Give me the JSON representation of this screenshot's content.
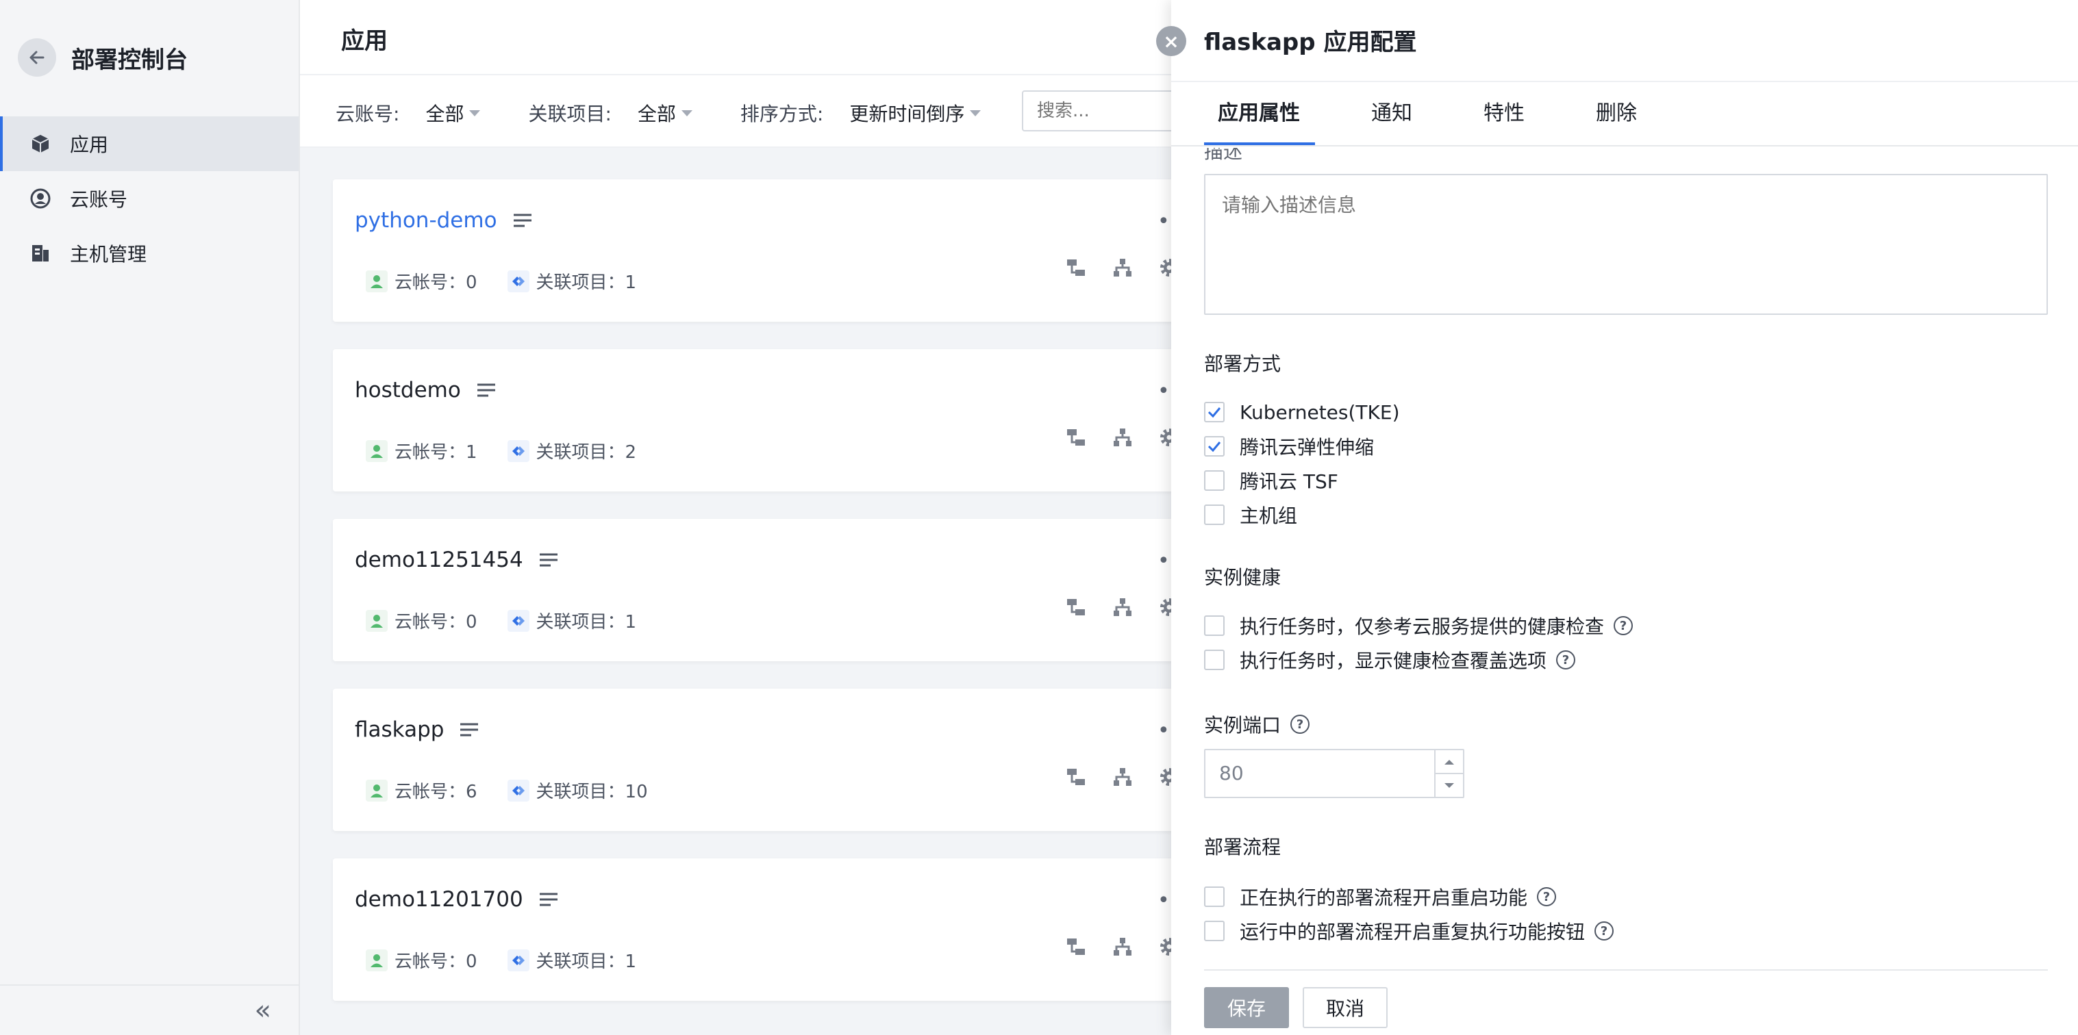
{
  "sidebar": {
    "title": "部署控制台",
    "items": [
      {
        "label": "应用",
        "icon": "cube-icon",
        "active": true
      },
      {
        "label": "云账号",
        "icon": "user-circle-icon",
        "active": false
      },
      {
        "label": "主机管理",
        "icon": "server-icon",
        "active": false
      }
    ],
    "collapse_glyph": "«"
  },
  "main": {
    "title": "应用",
    "filters": {
      "account_label": "云账号:",
      "account_value": "全部",
      "project_label": "关联项目:",
      "project_value": "全部",
      "sort_label": "排序方式:",
      "sort_value": "更新时间倒序"
    },
    "search_placeholder": "搜索...",
    "apps": [
      {
        "name": "python-demo",
        "is_link": true,
        "account_text": "云帐号：0",
        "project_text": "关联项目：1"
      },
      {
        "name": "hostdemo",
        "is_link": false,
        "account_text": "云帐号：1",
        "project_text": "关联项目：2"
      },
      {
        "name": "demo11251454",
        "is_link": false,
        "account_text": "云帐号：0",
        "project_text": "关联项目：1"
      },
      {
        "name": "flaskapp",
        "is_link": false,
        "account_text": "云帐号：6",
        "project_text": "关联项目：10"
      },
      {
        "name": "demo11201700",
        "is_link": false,
        "account_text": "云帐号：0",
        "project_text": "关联项目：1"
      }
    ]
  },
  "drawer": {
    "title": "flaskapp 应用配置",
    "tabs": [
      "应用属性",
      "通知",
      "特性",
      "删除"
    ],
    "desc_label": "描述",
    "desc_placeholder": "请输入描述信息",
    "deploy_method_label": "部署方式",
    "deploy_methods": [
      {
        "label": "Kubernetes(TKE)",
        "checked": true
      },
      {
        "label": "腾讯云弹性伸缩",
        "checked": true
      },
      {
        "label": "腾讯云 TSF",
        "checked": false
      },
      {
        "label": "主机组",
        "checked": false
      }
    ],
    "health_label": "实例健康",
    "health_options": [
      {
        "label": "执行任务时，仅参考云服务提供的健康检查",
        "checked": false
      },
      {
        "label": "执行任务时，显示健康检查覆盖选项",
        "checked": false
      }
    ],
    "port_label": "实例端口",
    "port_value": "80",
    "pipeline_label": "部署流程",
    "pipeline_options": [
      {
        "label": "正在执行的部署流程开启重启功能",
        "checked": false
      },
      {
        "label": "运行中的部署流程开启重复执行功能按钮",
        "checked": false
      }
    ],
    "save_label": "保存",
    "cancel_label": "取消",
    "help_glyph": "?",
    "close_glyph": "×"
  },
  "colors": {
    "accent": "#2f6fe4",
    "account_icon": "#52b96e",
    "project_icon": "#2f6fe4"
  }
}
